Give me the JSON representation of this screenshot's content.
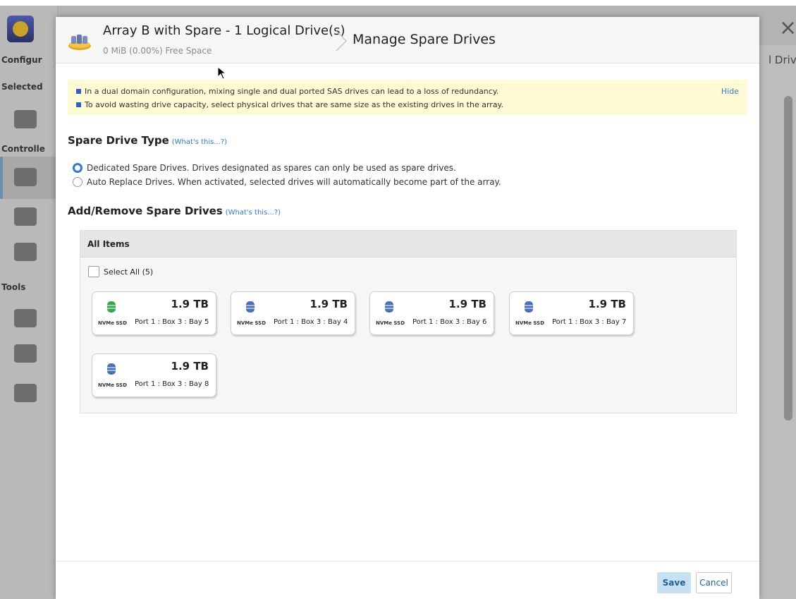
{
  "modal": {
    "array_title": "Array B with Spare - 1 Logical Drive(s)",
    "free_space": "0 MiB (0.00%) Free Space",
    "page_title": "Manage Spare Drives"
  },
  "notice": {
    "line1": "In a dual domain configuration, mixing single and dual ported SAS drives can lead to a loss of redundancy.",
    "line2": "To avoid wasting drive capacity, select physical drives that are same size as the existing drives in the array.",
    "hide_label": "Hide"
  },
  "spare_type": {
    "title": "Spare Drive Type",
    "help": "(What's this...?)",
    "options": [
      {
        "label": "Dedicated Spare Drives. Drives designated as spares can only be used as spare drives.",
        "selected": true
      },
      {
        "label": "Auto Replace Drives. When activated, selected drives will automatically become part of the array.",
        "selected": false
      }
    ]
  },
  "add_remove": {
    "title": "Add/Remove Spare Drives",
    "help": "(What's this...?)",
    "panel_title": "All Items",
    "select_all": "Select All (5)"
  },
  "drives": [
    {
      "size": "1.9 TB",
      "type": "NVMe SSD",
      "location": "Port 1 : Box 3 : Bay 5",
      "color": "#3aa655"
    },
    {
      "size": "1.9 TB",
      "type": "NVMe SSD",
      "location": "Port 1 : Box 3 : Bay 4",
      "color": "#4a6fb5"
    },
    {
      "size": "1.9 TB",
      "type": "NVMe SSD",
      "location": "Port 1 : Box 3 : Bay 6",
      "color": "#4a6fb5"
    },
    {
      "size": "1.9 TB",
      "type": "NVMe SSD",
      "location": "Port 1 : Box 3 : Bay 7",
      "color": "#4a6fb5"
    },
    {
      "size": "1.9 TB",
      "type": "NVMe SSD",
      "location": "Port 1 : Box 3 : Bay 8",
      "color": "#4a6fb5"
    }
  ],
  "footer": {
    "save_label": "Save",
    "cancel_label": "Cancel"
  },
  "background": {
    "sections": [
      "Configur",
      "Selected",
      "Controlle",
      "Tools"
    ],
    "right_header": "l Driv",
    "close_icon": "×"
  }
}
